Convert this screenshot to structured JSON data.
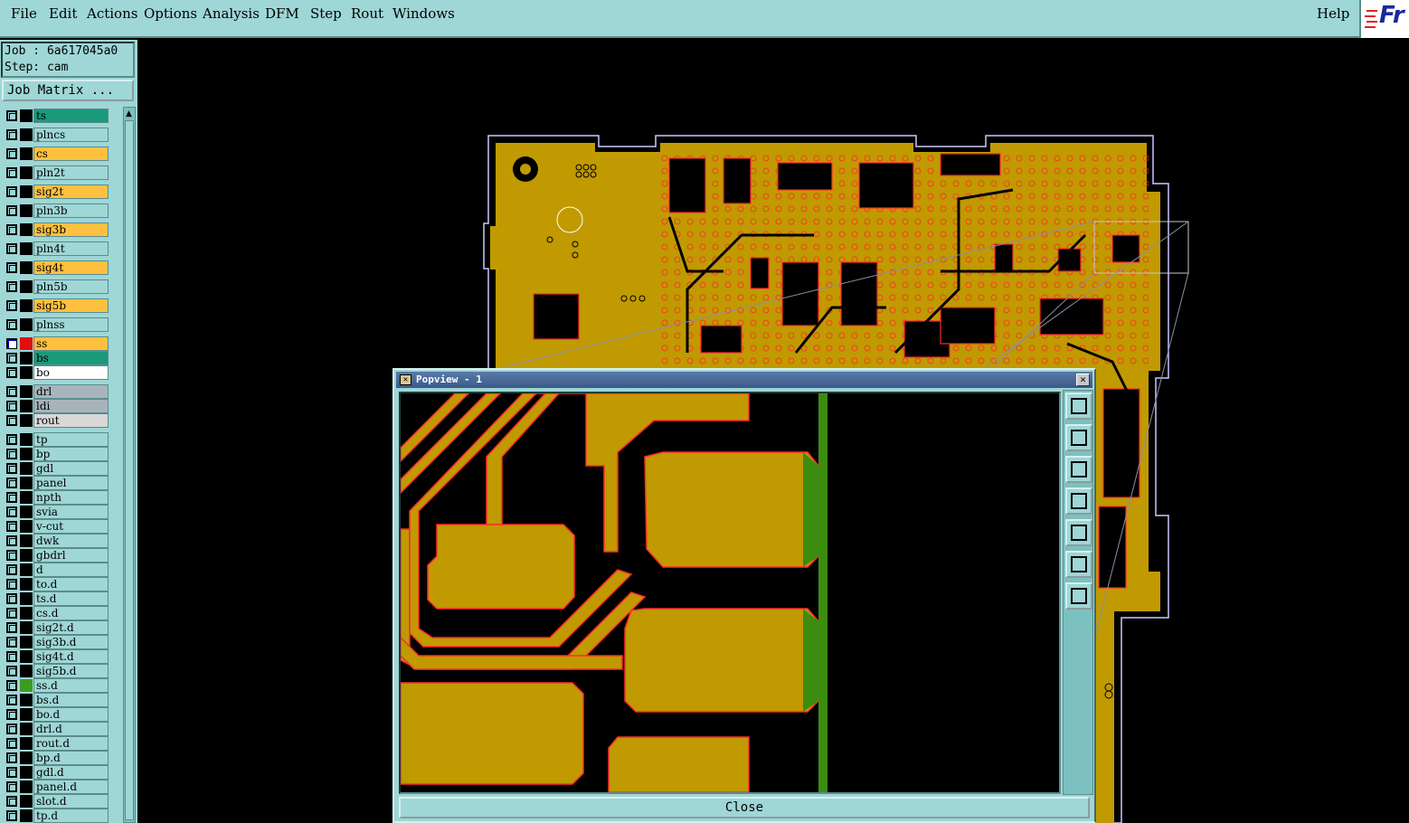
{
  "menubar": {
    "items": [
      "File",
      "Edit",
      "Actions",
      "Options",
      "Analysis",
      "DFM",
      "Step",
      "Rout",
      "Windows"
    ],
    "help": "Help",
    "logo_text": "Fr"
  },
  "job": {
    "job_label": "Job : 6a617045a0",
    "step_label": "Step: cam",
    "job_matrix_button": "Job Matrix ..."
  },
  "layers": [
    {
      "name": "ts",
      "color": "#1a9a7a"
    },
    {
      "name": "plncs",
      "color": "#9fd6d6"
    },
    {
      "name": "cs",
      "color": "#ffc040"
    },
    {
      "name": "pln2t",
      "color": "#9fd6d6"
    },
    {
      "name": "sig2t",
      "color": "#ffc040"
    },
    {
      "name": "pln3b",
      "color": "#9fd6d6"
    },
    {
      "name": "sig3b",
      "color": "#ffc040"
    },
    {
      "name": "pln4t",
      "color": "#9fd6d6"
    },
    {
      "name": "sig4t",
      "color": "#ffc040"
    },
    {
      "name": "pln5b",
      "color": "#9fd6d6"
    },
    {
      "name": "sig5b",
      "color": "#ffc040"
    },
    {
      "name": "plnss",
      "color": "#9fd6d6"
    },
    {
      "name": "ss",
      "color": "#ffc040"
    },
    {
      "name": "bs",
      "color": "#1a9a7a"
    },
    {
      "name": "bo",
      "color": "#ffffff"
    },
    {
      "name": "drl",
      "color": "#a8b4bc"
    },
    {
      "name": "ldi",
      "color": "#a8b4bc"
    },
    {
      "name": "rout",
      "color": "#d8d8d8"
    },
    {
      "name": "tp",
      "color": "#9fd6d6"
    },
    {
      "name": "bp",
      "color": "#9fd6d6"
    },
    {
      "name": "gdl",
      "color": "#9fd6d6"
    },
    {
      "name": "panel",
      "color": "#9fd6d6"
    },
    {
      "name": "npth",
      "color": "#9fd6d6"
    },
    {
      "name": "svia",
      "color": "#9fd6d6"
    },
    {
      "name": "v-cut",
      "color": "#9fd6d6"
    },
    {
      "name": "dwk",
      "color": "#9fd6d6"
    },
    {
      "name": "gbdrl",
      "color": "#9fd6d6"
    },
    {
      "name": "d",
      "color": "#9fd6d6"
    },
    {
      "name": "to.d",
      "color": "#9fd6d6"
    },
    {
      "name": "ts.d",
      "color": "#9fd6d6"
    },
    {
      "name": "cs.d",
      "color": "#9fd6d6"
    },
    {
      "name": "sig2t.d",
      "color": "#9fd6d6"
    },
    {
      "name": "sig3b.d",
      "color": "#9fd6d6"
    },
    {
      "name": "sig4t.d",
      "color": "#9fd6d6"
    },
    {
      "name": "sig5b.d",
      "color": "#9fd6d6"
    },
    {
      "name": "ss.d",
      "color": "#9fd6d6"
    },
    {
      "name": "bs.d",
      "color": "#9fd6d6"
    },
    {
      "name": "bo.d",
      "color": "#9fd6d6"
    },
    {
      "name": "drl.d",
      "color": "#9fd6d6"
    },
    {
      "name": "rout.d",
      "color": "#9fd6d6"
    },
    {
      "name": "bp.d",
      "color": "#9fd6d6"
    },
    {
      "name": "gdl.d",
      "color": "#9fd6d6"
    },
    {
      "name": "panel.d",
      "color": "#9fd6d6"
    },
    {
      "name": "slot.d",
      "color": "#9fd6d6"
    },
    {
      "name": "tp.d",
      "color": "#9fd6d6"
    }
  ],
  "popview": {
    "title": "Popview - 1",
    "close_label": "Close",
    "tools": [
      "zoom-home-icon",
      "pan-up-icon",
      "pan-down-icon",
      "pan-left-icon",
      "pan-right-icon",
      "zoom-in-icon",
      "zoom-out-icon"
    ]
  },
  "colors": {
    "ui": "#9fd6d6",
    "copper": "#c09a00",
    "trace_outline": "#ff2a2a",
    "solder_green": "#3c8c10"
  }
}
